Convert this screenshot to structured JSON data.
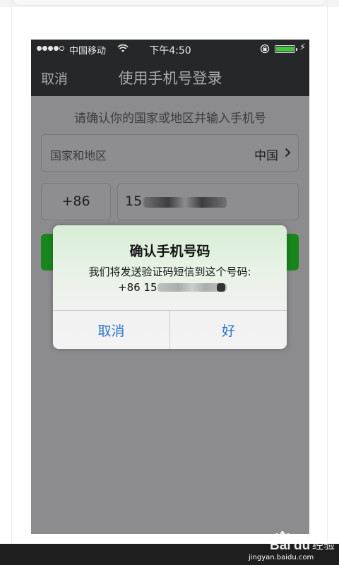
{
  "status_bar": {
    "carrier": "中国移动",
    "time": "下午4:50",
    "signal_bars": 4,
    "battery_level": 1.0,
    "battery_color": "#46c343"
  },
  "nav": {
    "cancel_label": "取消",
    "title": "使用手机号登录"
  },
  "form": {
    "prompt": "请确认你的国家或地区并输入手机号",
    "region_label": "国家和地区",
    "region_value": "中国",
    "country_code": "+86",
    "phone_prefix": "15",
    "next_button_color": "#18861c"
  },
  "dialog": {
    "title": "确认手机号码",
    "message": "我们将发送验证码短信到这个号码:",
    "number_prefix": "+86 15",
    "cancel_label": "取消",
    "ok_label": "好",
    "button_color": "#2c74c9"
  },
  "watermark": {
    "brand": "Bai du",
    "suffix": "经验",
    "domain": "jingyan.baidu.com"
  }
}
